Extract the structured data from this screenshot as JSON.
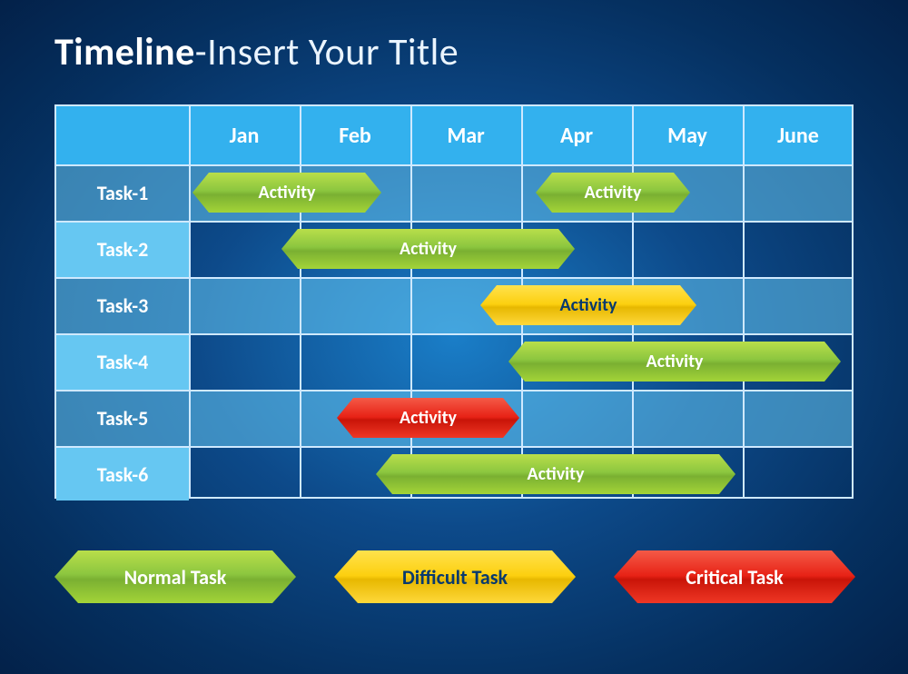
{
  "title": {
    "bold": "Timeline",
    "rest": "-Insert Your Title"
  },
  "chart_data": {
    "type": "bar",
    "title": "Timeline-Insert Your Title",
    "xlabel": "",
    "ylabel": "",
    "categories": [
      "Jan",
      "Feb",
      "Mar",
      "Apr",
      "May",
      "June"
    ],
    "x": [
      1,
      2,
      3,
      4,
      5,
      6
    ],
    "tasks": [
      "Task-1",
      "Task-2",
      "Task-3",
      "Task-4",
      "Task-5",
      "Task-6"
    ],
    "series": [
      {
        "name": "Task-1",
        "bars": [
          {
            "label": "Activity",
            "start": 0.5,
            "end": 2.2,
            "type": "normal"
          },
          {
            "label": "Activity",
            "start": 3.6,
            "end": 5.0,
            "type": "normal"
          }
        ]
      },
      {
        "name": "Task-2",
        "bars": [
          {
            "label": "Activity",
            "start": 1.3,
            "end": 3.95,
            "type": "normal"
          }
        ]
      },
      {
        "name": "Task-3",
        "bars": [
          {
            "label": "Activity",
            "start": 3.1,
            "end": 5.05,
            "type": "difficult"
          }
        ]
      },
      {
        "name": "Task-4",
        "bars": [
          {
            "label": "Activity",
            "start": 3.35,
            "end": 6.35,
            "type": "normal"
          }
        ]
      },
      {
        "name": "Task-5",
        "bars": [
          {
            "label": "Activity",
            "start": 1.8,
            "end": 3.45,
            "type": "critical"
          }
        ]
      },
      {
        "name": "Task-6",
        "bars": [
          {
            "label": "Activity",
            "start": 2.15,
            "end": 5.4,
            "type": "normal"
          }
        ]
      }
    ],
    "legend": [
      {
        "label": "Normal Task",
        "type": "normal"
      },
      {
        "label": "Difficult Task",
        "type": "difficult"
      },
      {
        "label": "Critical Task",
        "type": "critical"
      }
    ]
  },
  "colors": {
    "normal": "#8cc63f",
    "difficult": "#fccf0f",
    "critical": "#e72216"
  }
}
